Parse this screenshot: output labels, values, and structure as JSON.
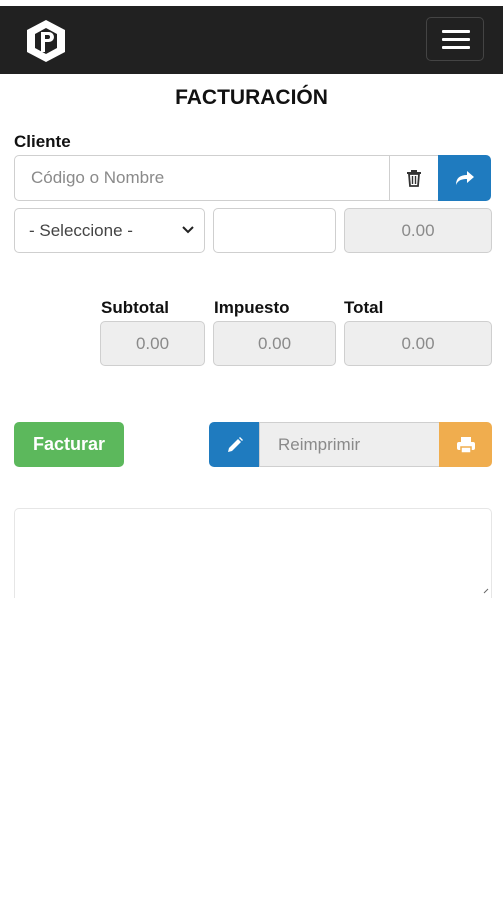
{
  "header": {
    "logo_icon": "box-logo-icon",
    "menu_icon": "hamburger-icon"
  },
  "page": {
    "title": "FACTURACIÓN"
  },
  "client": {
    "label": "Cliente",
    "search_placeholder": "Código o Nombre",
    "delete_icon": "trash-icon",
    "go_icon": "share-arrow-icon",
    "select_value": "- Seleccione -",
    "quantity_value": "",
    "amount_value": "0.00"
  },
  "totals": {
    "subtotal_label": "Subtotal",
    "subtotal_value": "0.00",
    "tax_label": "Impuesto",
    "tax_value": "0.00",
    "total_label": "Total",
    "total_value": "0.00"
  },
  "actions": {
    "invoice_label": "Facturar",
    "edit_icon": "pencil-icon",
    "reprint_placeholder": "Reimprimir",
    "print_icon": "print-icon"
  },
  "colors": {
    "primary": "#1f7bbf",
    "success": "#5cb85c",
    "warning": "#f0ad4e",
    "navbar": "#212121"
  }
}
